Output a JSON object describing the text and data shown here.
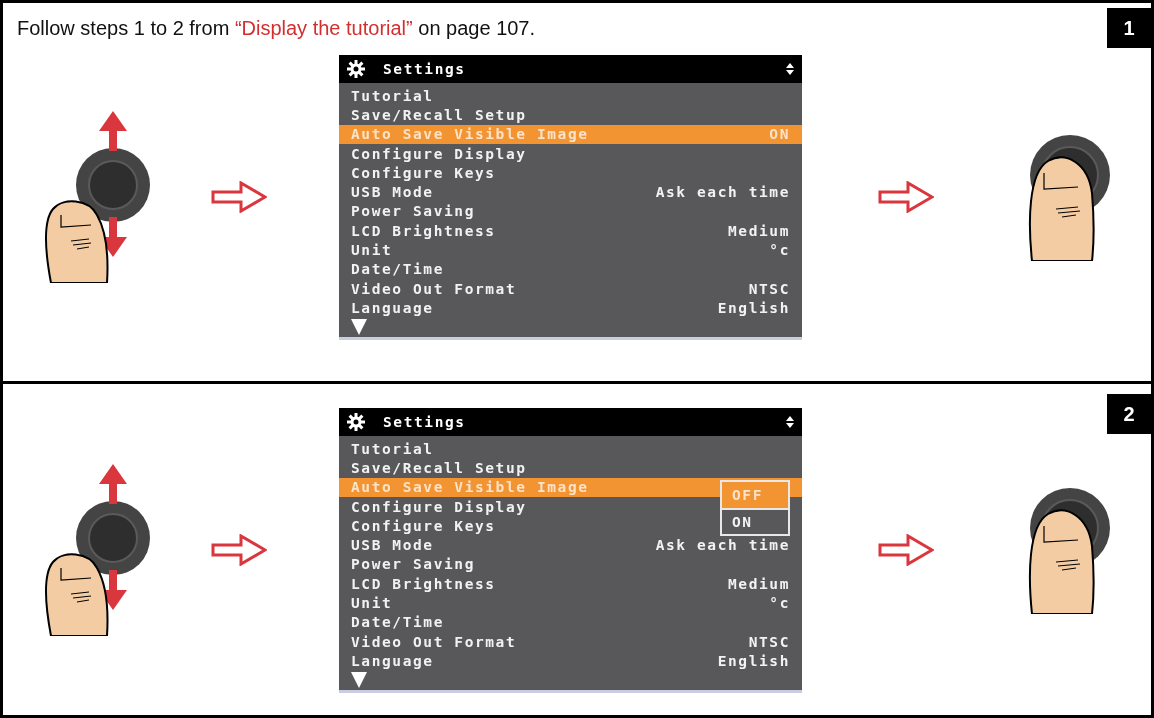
{
  "steps": [
    {
      "number": "1",
      "instruction": {
        "before": "Follow steps 1 to 2 from ",
        "link": "“Display the tutorial”",
        "after": " on page 107."
      },
      "screen": {
        "title": "Settings",
        "items": [
          {
            "label": "Tutorial",
            "selected": false
          },
          {
            "label": "Save/Recall Setup",
            "selected": false
          },
          {
            "label": "Auto Save Visible Image",
            "value": "ON",
            "selected": true
          },
          {
            "label": "Configure Display",
            "selected": false
          },
          {
            "label": "Configure Keys",
            "selected": false
          },
          {
            "label": "USB Mode",
            "value": "Ask each time",
            "selected": false
          },
          {
            "label": "Power Saving",
            "selected": false
          },
          {
            "label": "LCD Brightness",
            "value": "Medium",
            "selected": false
          },
          {
            "label": "Unit",
            "value": "°c",
            "selected": false
          },
          {
            "label": "Date/Time",
            "selected": false
          },
          {
            "label": "Video Out Format",
            "value": "NTSC",
            "selected": false
          },
          {
            "label": "Language",
            "value": "English",
            "selected": false
          }
        ]
      }
    },
    {
      "number": "2",
      "screen": {
        "title": "Settings",
        "items": [
          {
            "label": "Tutorial",
            "selected": false
          },
          {
            "label": "Save/Recall Setup",
            "selected": false
          },
          {
            "label": "Auto Save Visible Image",
            "selected": true
          },
          {
            "label": "Configure Display",
            "selected": false
          },
          {
            "label": "Configure Keys",
            "selected": false
          },
          {
            "label": "USB Mode",
            "value": "Ask each time",
            "selected": false
          },
          {
            "label": "Power Saving",
            "selected": false
          },
          {
            "label": "LCD Brightness",
            "value": "Medium",
            "selected": false
          },
          {
            "label": "Unit",
            "value": "°c",
            "selected": false
          },
          {
            "label": "Date/Time",
            "selected": false
          },
          {
            "label": "Video Out Format",
            "value": "NTSC",
            "selected": false
          },
          {
            "label": "Language",
            "value": "English",
            "selected": false
          }
        ],
        "popup": [
          {
            "label": "OFF",
            "selected": true
          },
          {
            "label": "ON",
            "selected": false
          }
        ]
      }
    }
  ]
}
